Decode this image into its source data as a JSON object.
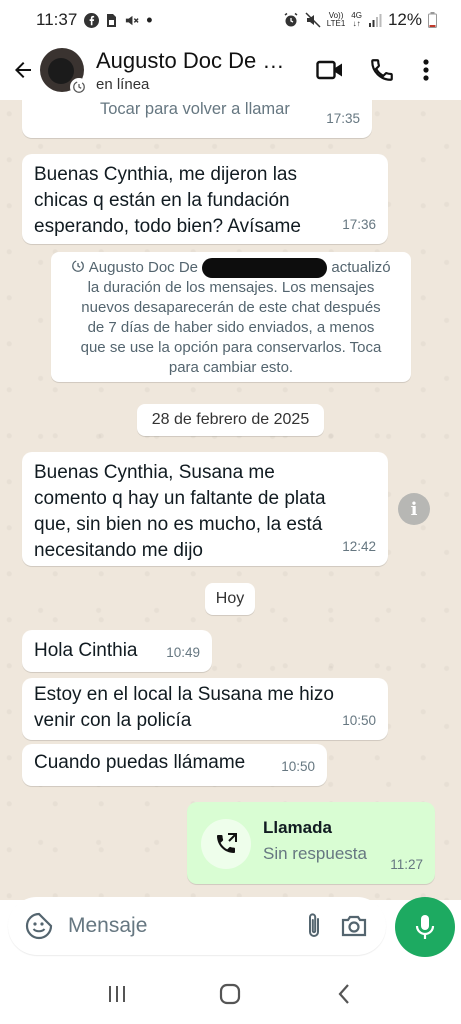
{
  "status_bar": {
    "time": "11:37",
    "net_top": "Vo))",
    "net_bottom": "LTE1",
    "gen_top": "4G",
    "gen_bottom": "↓↑",
    "battery_pct": "12%"
  },
  "header": {
    "contact_name": "Augusto Doc De S...",
    "status": "en línea"
  },
  "messages": [
    {
      "type": "call_partial",
      "text": "Tocar para volver a llamar",
      "time": "17:35"
    },
    {
      "type": "in",
      "lines": [
        "Buenas Cynthia, me dijeron las",
        "chicas q están en la fundación",
        "esperando, todo bien? Avísame"
      ],
      "time": "17:36"
    },
    {
      "type": "system",
      "name": "Augusto Doc De",
      "action": "actualizó",
      "lines": [
        "la duración de los mensajes. Los mensajes",
        "nuevos desaparecerán de este chat después",
        "de 7 días de haber sido enviados, a menos",
        "que se use la opción para conservarlos. Toca",
        "para cambiar esto."
      ]
    },
    {
      "type": "date",
      "text": "28 de febrero de 2025"
    },
    {
      "type": "in",
      "lines": [
        "Buenas Cynthia, Susana me",
        "comento q hay un faltante de plata",
        "que, sin bien no es mucho, la está",
        "necesitando me dijo"
      ],
      "time": "12:42"
    },
    {
      "type": "date",
      "text": "Hoy"
    },
    {
      "type": "in",
      "lines": [
        "Hola Cinthia"
      ],
      "time": "10:49"
    },
    {
      "type": "in",
      "lines": [
        "Estoy en el local la Susana me hizo",
        "venir con la policía"
      ],
      "time": "10:50"
    },
    {
      "type": "in",
      "lines": [
        "Cuando puedas llámame"
      ],
      "time": "10:50"
    },
    {
      "type": "out_call",
      "title": "Llamada",
      "subtitle": "Sin respuesta",
      "time": "11:27"
    }
  ],
  "input": {
    "placeholder": "Mensaje"
  },
  "colors": {
    "chat_bg": "#efe7dc",
    "incoming": "#ffffff",
    "outgoing": "#d9fdd3",
    "accent": "#1daa61"
  }
}
